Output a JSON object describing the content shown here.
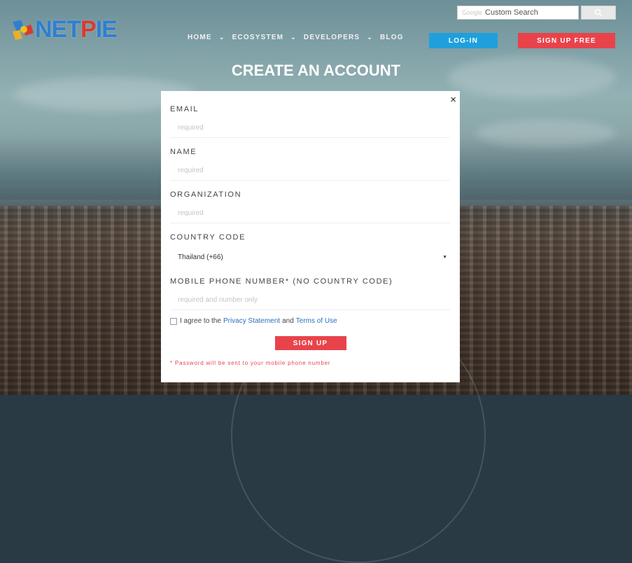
{
  "header": {
    "logo_text": "NETPIE",
    "nav": [
      {
        "label": "HOME",
        "has_dropdown": true
      },
      {
        "label": "ECOSYSTEM",
        "has_dropdown": true
      },
      {
        "label": "DEVELOPERS",
        "has_dropdown": true
      },
      {
        "label": "BLOG",
        "has_dropdown": false
      }
    ],
    "search": {
      "google_label": "Google",
      "placeholder": "Custom Search"
    },
    "login_label": "LOG-IN",
    "signup_free_label": "SIGN UP FREE"
  },
  "page_title": "CREATE AN ACCOUNT",
  "modal": {
    "close_glyph": "×",
    "fields": [
      {
        "label": "EMAIL",
        "placeholder": "required"
      },
      {
        "label": "NAME",
        "placeholder": "required"
      },
      {
        "label": "ORGANIZATION",
        "placeholder": "required"
      }
    ],
    "country": {
      "label": "COUNTRY CODE",
      "value": "Thailand (+66)"
    },
    "phone": {
      "label": "MOBILE PHONE NUMBER* (NO COUNTRY CODE)",
      "placeholder": "required and number only"
    },
    "agree": {
      "prefix": "I agree to the",
      "privacy_link": "Privacy Statement",
      "and": "and",
      "terms_link": "Terms of Use"
    },
    "signup_label": "SIGN UP",
    "note": "* Password will be sent to your mobile phone number"
  },
  "colors": {
    "login": "#1fa0dd",
    "signup": "#e8434b",
    "link": "#2a6fbd"
  },
  "icons": {
    "search_button": "search-icon",
    "close": "close-icon",
    "select_caret": "caret-down-icon"
  }
}
